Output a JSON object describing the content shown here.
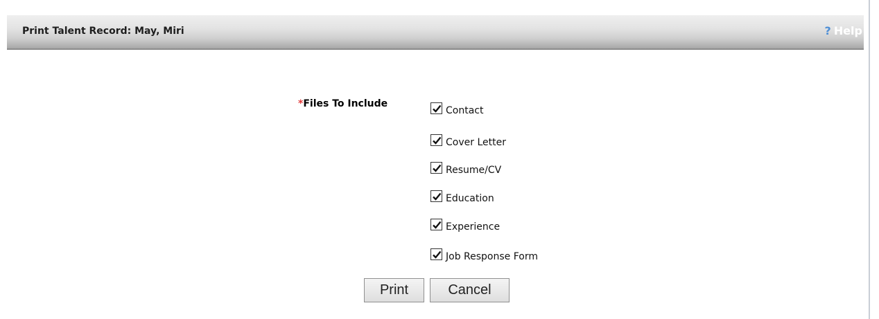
{
  "header": {
    "title": "Print Talent Record: May, Miri",
    "help_symbol": "?",
    "help_label": "Help"
  },
  "form": {
    "required_marker": "*",
    "files_label": "Files To Include",
    "options": [
      {
        "label": "Contact",
        "checked": true
      },
      {
        "label": "Cover Letter",
        "checked": true
      },
      {
        "label": "Resume/CV",
        "checked": true
      },
      {
        "label": "Education",
        "checked": true
      },
      {
        "label": "Experience",
        "checked": true
      },
      {
        "label": "Job Response Form",
        "checked": true
      }
    ]
  },
  "buttons": {
    "print_label": "Print",
    "cancel_label": "Cancel"
  },
  "colors": {
    "required_marker": "#e23a3a",
    "help_question": "#4f8fd6",
    "header_text": "#1e1e1e"
  },
  "icons": {
    "checkbox_checked": "checkmark-icon",
    "help": "help-question-icon"
  }
}
